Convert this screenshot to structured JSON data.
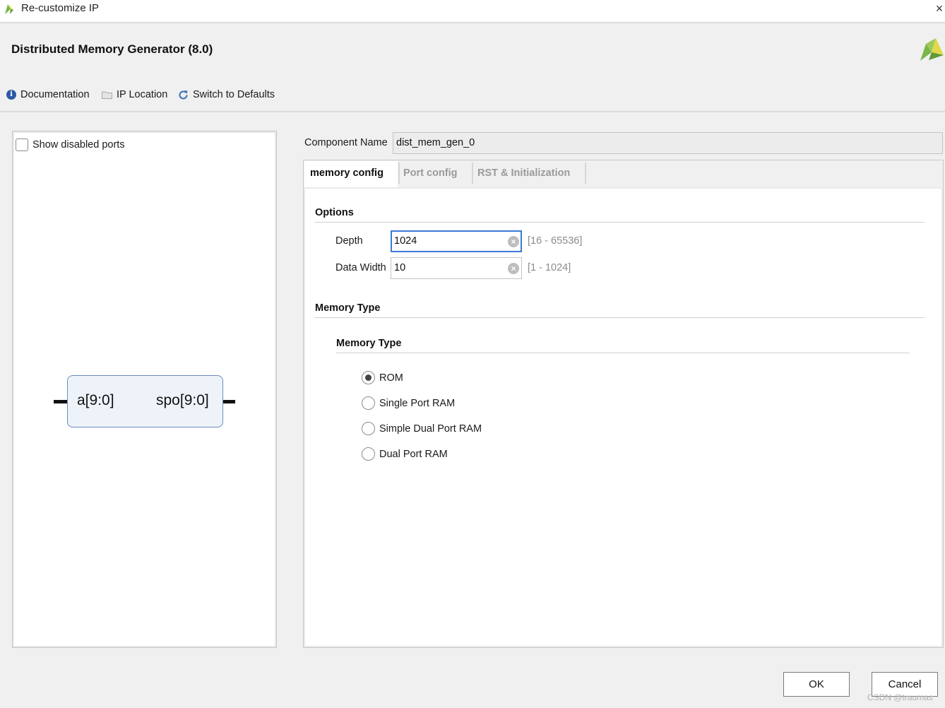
{
  "window": {
    "title": "Re-customize IP",
    "close_glyph": "×"
  },
  "header": {
    "title": "Distributed Memory Generator (8.0)"
  },
  "toolbar": {
    "documentation_label": "Documentation",
    "ip_location_label": "IP Location",
    "switch_defaults_label": "Switch to Defaults"
  },
  "left_panel": {
    "show_disabled_ports_label": "Show disabled ports",
    "show_disabled_ports_checked": false,
    "symbol": {
      "input_port": "a[9:0]",
      "output_port": "spo[9:0]"
    }
  },
  "component": {
    "label": "Component Name",
    "value": "dist_mem_gen_0"
  },
  "tabs": [
    {
      "label": "memory config",
      "active": true
    },
    {
      "label": "Port config",
      "active": false
    },
    {
      "label": "RST & Initialization",
      "active": false
    }
  ],
  "options": {
    "title": "Options",
    "depth": {
      "label": "Depth",
      "value": "1024",
      "range": "[16 - 65536]"
    },
    "data_width": {
      "label": "Data Width",
      "value": "10",
      "range": "[1 - 1024]"
    }
  },
  "memory_type": {
    "title": "Memory Type",
    "subtitle": "Memory Type",
    "selected": "ROM",
    "options": [
      "ROM",
      "Single Port RAM",
      "Simple Dual Port RAM",
      "Dual Port RAM"
    ]
  },
  "footer": {
    "ok_label": "OK",
    "cancel_label": "Cancel"
  },
  "watermark": "CSDN @traumas",
  "colors": {
    "accent": "#3c78d8",
    "logo_green": "#7ab648",
    "logo_yellow": "#e2d94a"
  }
}
